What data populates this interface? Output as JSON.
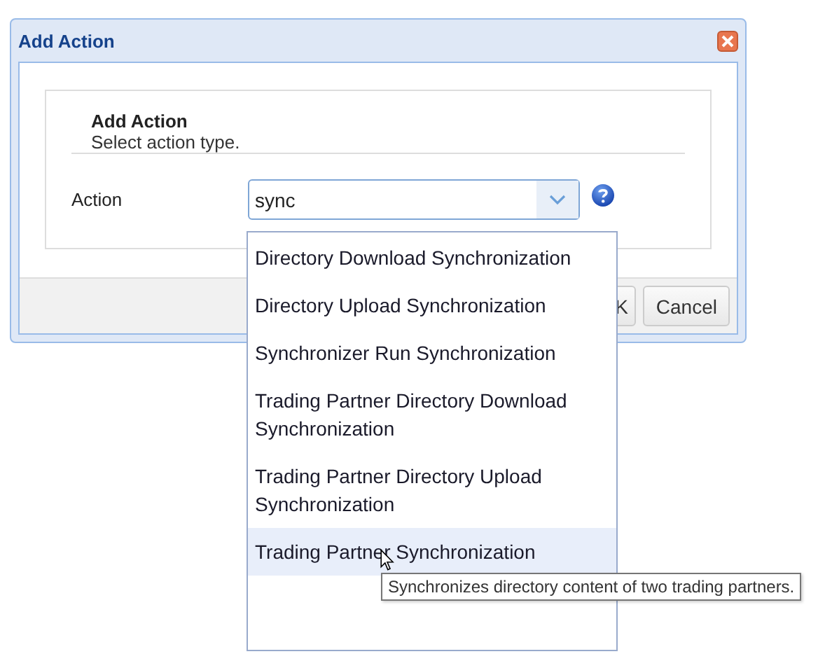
{
  "window": {
    "title": "Add Action"
  },
  "header": {
    "title": "Add Action",
    "subtitle": "Select action type."
  },
  "form": {
    "label": "Action",
    "value": "sync"
  },
  "buttons": [
    "K",
    "Cancel"
  ],
  "dropdown": {
    "items": [
      {
        "label": "Directory Download Synchronization",
        "selected": false
      },
      {
        "label": "Directory Upload Synchronization",
        "selected": false
      },
      {
        "label": "Synchronizer Run Synchronization",
        "selected": false
      },
      {
        "label": "Trading Partner Directory Download Synchronization",
        "selected": false
      },
      {
        "label": "Trading Partner Directory Upload Synchronization",
        "selected": false
      },
      {
        "label": "Trading Partner Synchronization",
        "selected": true
      }
    ]
  },
  "tooltip": "Synchronizes directory content of two trading partners."
}
